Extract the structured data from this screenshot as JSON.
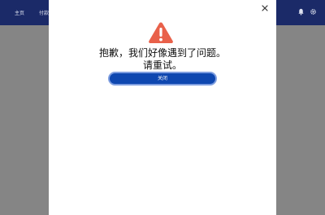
{
  "nav": {
    "home_label": "主页",
    "pay_label": "付款"
  },
  "dialog": {
    "message_line1": "抱歉，我们好像遇到了问题。",
    "message_line2": "请重试。",
    "close_button_label": "关闭",
    "icon": "warning-triangle-icon"
  },
  "colors": {
    "topbar": "#1b2a68",
    "overlay": "#858585",
    "warning": "#e9614a",
    "primary_button": "#0e47b0",
    "primary_button_border": "#7e9ee0"
  }
}
